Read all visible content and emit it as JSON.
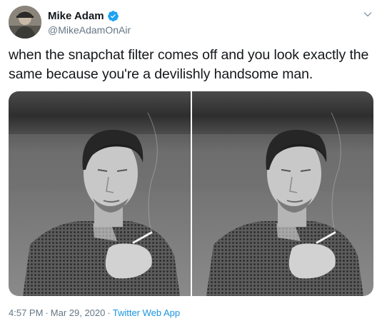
{
  "author": {
    "display_name": "Mike Adam",
    "handle": "@MikeAdamOnAir",
    "verified": true,
    "avatar_icon": "avatar-photo"
  },
  "tweet": {
    "text": "when the snapchat filter comes off and you look exactly the same because you're a devilishly handsome man.",
    "media": [
      {
        "description_icon": "photo-icon"
      },
      {
        "description_icon": "photo-icon"
      }
    ]
  },
  "meta": {
    "time": "4:57 PM",
    "separator": "·",
    "date": "Mar 29, 2020",
    "source": "Twitter Web App"
  },
  "colors": {
    "text": "#14171a",
    "secondary": "#657786",
    "link": "#1b95e0",
    "verified": "#1da1f2"
  }
}
